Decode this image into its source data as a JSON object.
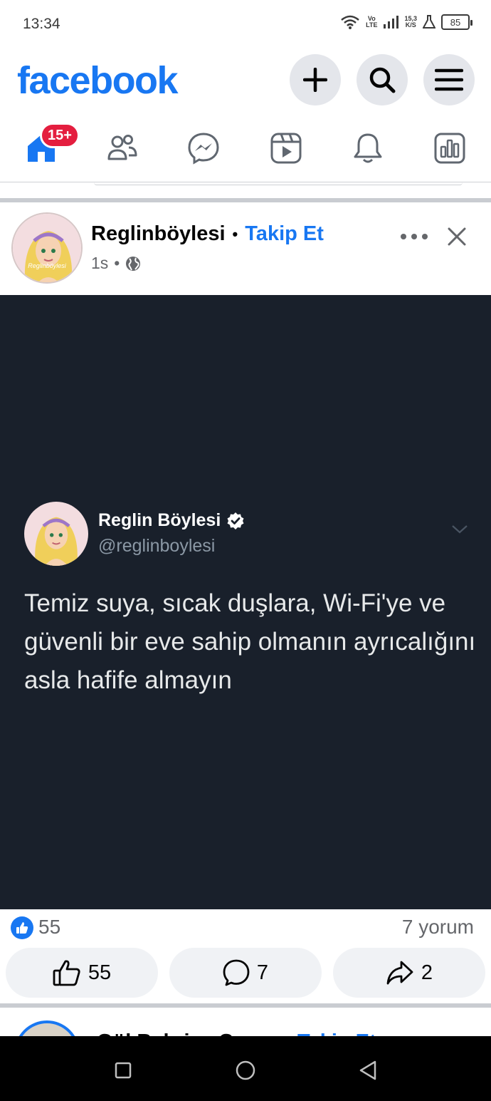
{
  "status_bar": {
    "time": "13:34",
    "volte_top": "Vo",
    "volte_bottom": "LTE",
    "speed_value": "15,3",
    "speed_unit": "K/S",
    "battery": "85"
  },
  "header": {
    "logo": "facebook",
    "buttons": [
      "plus-icon",
      "search-icon",
      "menu-icon"
    ]
  },
  "nav": {
    "badge": "15+",
    "items": [
      "home-icon",
      "friends-icon",
      "messenger-icon",
      "video-icon",
      "notifications-icon",
      "dashboard-icon"
    ]
  },
  "post": {
    "author": "Reglinböylesi",
    "separator": "•",
    "follow_label": "Takip Et",
    "time": "1s",
    "meta_separator": "•",
    "avatar_caption": "Reglinböylesi",
    "tweet": {
      "name": "Reglin Böylesi",
      "handle": "@reglinboylesi",
      "text": "Temiz suya, sıcak duşlara, Wi-Fi'ye ve güvenli bir eve sahip olmanın ayrıcalığını asla hafife almayın"
    },
    "reaction_count": "55",
    "comment_summary": "7 yorum",
    "actions": {
      "like_count": "55",
      "comment_count": "7",
      "share_count": "2"
    }
  },
  "next_post": {
    "author": "Gül Bahriye Can",
    "follow_label": "Takip Et"
  },
  "colors": {
    "brand": "#1877f2",
    "tweet_bg": "#19202b",
    "badge": "#e41e3f"
  }
}
